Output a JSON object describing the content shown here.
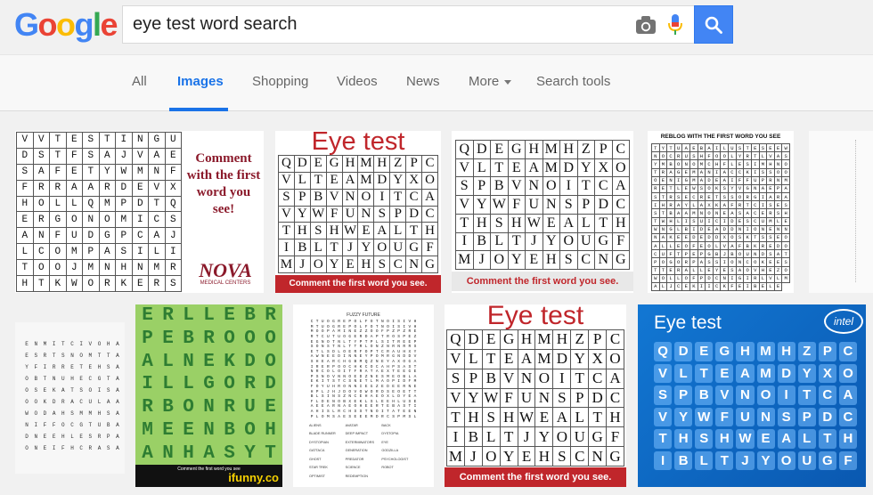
{
  "header": {
    "logo_letters": [
      {
        "ch": "G",
        "color": "#4285F4"
      },
      {
        "ch": "o",
        "color": "#EA4335"
      },
      {
        "ch": "o",
        "color": "#FBBC05"
      },
      {
        "ch": "g",
        "color": "#4285F4"
      },
      {
        "ch": "l",
        "color": "#34A853"
      },
      {
        "ch": "e",
        "color": "#EA4335"
      }
    ],
    "query": "eye test word search",
    "camera_icon": "camera-icon",
    "mic_icon": "microphone-icon",
    "search_icon": "magnifier-icon"
  },
  "tabs": [
    {
      "label": "All",
      "active": false
    },
    {
      "label": "Images",
      "active": true
    },
    {
      "label": "Shopping",
      "active": false
    },
    {
      "label": "Videos",
      "active": false
    },
    {
      "label": "News",
      "active": false
    },
    {
      "label": "More",
      "active": false
    },
    {
      "label": "Search tools",
      "active": false
    }
  ],
  "results": {
    "r1": {
      "rows": [
        "VVTESTINGU",
        "DSTFSAJVAE",
        "SAFETYWMNF",
        "FRRAARDEVX",
        "HOLLQMPDTQ",
        "ERGONOMICS",
        "ANFUDGPCAJ",
        "LCOMPASILI",
        "TOOJMNHNMR",
        "HTKWORKERS"
      ],
      "caption_lines": [
        "Comment",
        "with the first",
        "word you",
        "see!"
      ],
      "brand": "NOVA",
      "brand_sub": "MEDICAL CENTERS"
    },
    "r2": {
      "title": "Eye test",
      "rows": [
        "QDEGHMHZPC",
        "VLTEAMDYXO",
        "SPBVNOITCA",
        "VYWFUNSPDC",
        "THSHWEALTH",
        "IBLTJYOUGF",
        "MJOYEHSCNG"
      ],
      "caption": "Comment the first word you see."
    },
    "r3": {
      "rows": [
        "QDEGHMHZPC",
        "VLTEAMDYXO",
        "SPBVNOITCA",
        "VYWFUNSPDC",
        "THSHWEALTH",
        "IBLTJYOUGF",
        "MJOYEHSCNG"
      ],
      "caption": "Comment the first word you see."
    },
    "r4": {
      "header": "REBLOG WITH THE FIRST WORD YOU SEE",
      "rows": [
        "TYTUAEBAILUSTESEE",
        "WNOCRUSHFOOLYRTLVA",
        "SYMBONOMCHFLESIMHN",
        "OTRAGEMANIACCKISSO",
        "OOENIGMADEAIFFUPR",
        "NMRETLEWSOKSYVGNAE",
        "PASTRSECRETSSORGIA",
        "RAIHRAYLAXKAFRTCIS",
        "ESSTBAAMNONEASACER",
        "SHTWHLISUICIDESCUM",
        "LEWNGLBIDEADDNIONE",
        "NNNAKEEDEDDXOSKTSS",
        "EOALLEOFEOLVAFBKRE",
        "DOCUFTPEPGBJBOUNDS",
        "ATPOGORPASSIONCOKE",
        "ESTTERALLEYESAOVHE",
        "ZOWOLLOFPDCNIGIRLV",
        "LMALJCEKIICKFEIBELE"
      ]
    },
    "r6": {
      "rows": [
        "ENMITCIVOHA",
        "ESRTSNOMTTA",
        "YFIRRETEHSA",
        "OBTNUHECGTA",
        "OSEKATSOISA",
        "OOKDRACULAA",
        "WODAHSMMHSA",
        "NIFFOCGTUBA",
        "DNEEHLESRPA",
        "ONEIFHCRASA"
      ]
    },
    "r7": {
      "rows": [
        "ERLLEBR",
        "PEBROOO",
        "ALNEKDO",
        "ILLGORD",
        "RBONRUE",
        "MEENBOH",
        "ANHASYT"
      ],
      "caption": "Comment the first word you see",
      "brand": "ifunny.co"
    },
    "r8": {
      "title": "FUZZY FUTURE",
      "rows": [
        "CTUOGREPOLFOTNOISIVH",
        "MTUOGREPOLFOTNOISIVH",
        "MOOPAMINEZZOOFPZPZRE",
        "RTCUTUOGERDAPTROSPEZ",
        "EGNOTNLTYPTPLSITREEP",
        "SONSTNLTTRLONZNRNRRS",
        "ETLSDLOERFOPTCRAUHXY",
        "AWNEEDINNEYPOMRGNDDV",
        "SHEARCHGBMQZNEYAXOGA",
        "IRERPOOCHKCOCAHPSAST",
        "NRCOLOITFRATAEXTEEGE",
        "PSNOVNNOEDZNESMEOBLA",
        "EKITSTCSNETLMAOPIDFM",
        "FOYUHRONNIEGZEDEERNE",
        "HPLJHJDOVOWORDSEOETT",
        "BLSINSZNCEHAEOXLDYEA",
        "FLDENOBXEKLSLEEHLUSE",
        "AEEARNAEOHEERTEBASTI",
        "AHISLRCHSSTNOITATEEN",
        "PLOMSAESEEEMDRCSPMSL"
      ],
      "words": [
        "ALIENS",
        "AVATAR",
        "BACK",
        "BLADE RUNNER",
        "DEEP IMPACT",
        "DYSTOPIA",
        "DYSTOPIAN",
        "EXTERMINATORS",
        "EYE",
        "GATTACA",
        "GENERATION",
        "GODZILLA",
        "GHOST",
        "PREDATOR",
        "PSYCHOLOGIST",
        "STAR TREK",
        "SCIENCE",
        "ROBOT",
        "OPTIMIST",
        "REDEMPTION"
      ]
    },
    "r9": {
      "title": "Eye test",
      "rows": [
        "QDEGHMHZPC",
        "VLTEAMDYXO",
        "SPBVNOITCA",
        "VYWFUNSPDC",
        "THSHWEALTH",
        "IBLTJYOUGF",
        "MJOYEHSCNG"
      ],
      "caption": "Comment the first word you see."
    },
    "r10": {
      "title": "Eye test",
      "brand": "intel",
      "rows": [
        "QDEGHMHZPC",
        "VLTEAMDYXO",
        "SPBVNOITCA",
        "VYWFUNSPDC",
        "THSHWEALTH",
        "IBLTJYOUGF"
      ]
    }
  }
}
